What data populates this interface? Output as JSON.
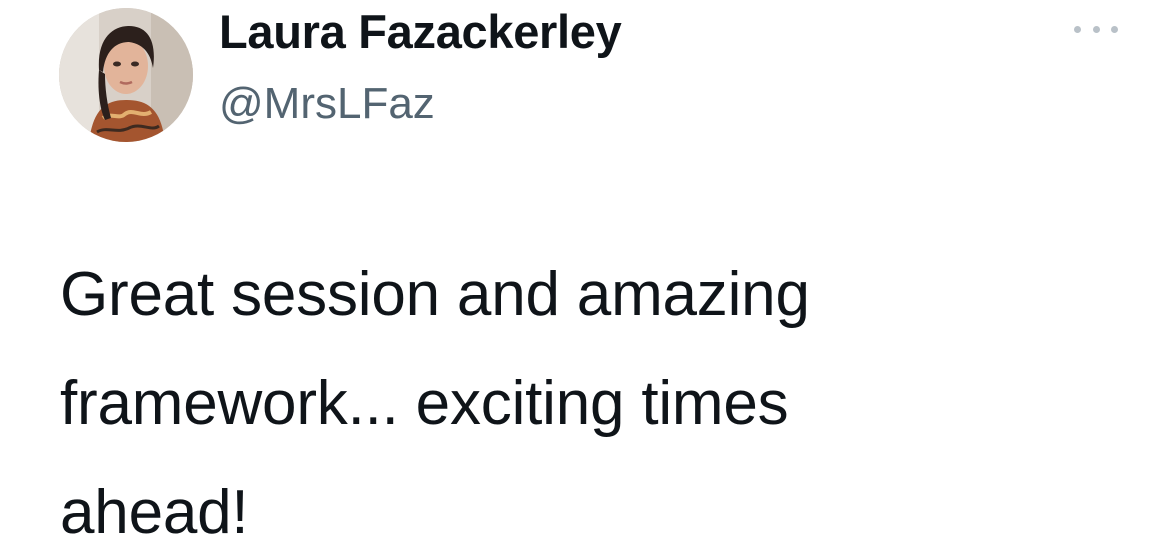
{
  "tweet": {
    "author": {
      "display_name": "Laura Fazackerley",
      "handle": "@MrsLFaz"
    },
    "more_icon": "more-horizontal-icon",
    "text_lines": [
      "Great session and amazing",
      "framework... exciting times",
      "ahead!"
    ]
  },
  "colors": {
    "text_primary": "#0f1419",
    "text_secondary": "#536471",
    "icon_muted": "#b9c1c8",
    "background": "#ffffff"
  }
}
